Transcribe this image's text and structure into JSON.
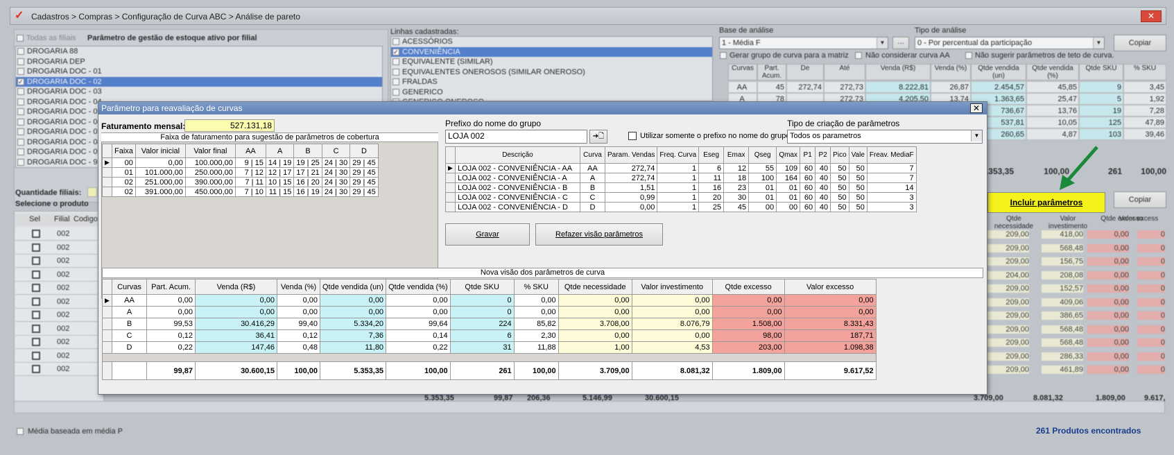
{
  "window": {
    "title": "Cadastros > Compras > Configuração de Curva ABC > Análise de pareto",
    "close": "✕"
  },
  "left_panel": {
    "todas_label": "Todas as filiais",
    "header": "Parâmetro de gestão de estoque ativo por filial",
    "stores": [
      "DROGARIA 88",
      "DROGARIA DEP",
      "DROGARIA DOC - 01",
      "DROGARIA DOC - 02",
      "DROGARIA DOC - 03",
      "DROGARIA DOC - 04",
      "DROGARIA DOC - 05",
      "DROGARIA DOC - 06",
      "DROGARIA DOC - 07",
      "DROGARIA DOC - 08",
      "DROGARIA DOC - 09",
      "DROGARIA DOC - 98"
    ],
    "qtd_filiais": "Quantidade filiais:",
    "selecione": "Selecione o produto"
  },
  "lines_panel": {
    "header": "Linhas cadastradas:",
    "items": [
      "ACESSÓRIOS",
      "CONVENIÊNCIA",
      "EQUIVALENTE (SIMILAR)",
      "EQUIVALENTES ONEROSOS (SIMILAR ONEROSO)",
      "FRALDAS",
      "GENERICO",
      "GENERICO ONEROSO"
    ]
  },
  "right_panel": {
    "base_label": "Base de análise",
    "base_value": "1 - Média F",
    "tipo_label": "Tipo de análise",
    "tipo_value": "0 - Por percentual da participação",
    "copiar": "Copiar",
    "chk1": "Gerar grupo de curva para a matriz",
    "chk2": "Não considerar curva AA",
    "chk3": "Não sugerir parâmetros de teto de curva.",
    "cols": [
      "Curvas",
      "Part. Acum.",
      "De",
      "Até",
      "Venda (R$)",
      "Venda (%)",
      "Qtde vendida (un)",
      "Qtde vendida (%)",
      "Qtde SKU",
      "% SKU"
    ],
    "rows": [
      [
        "AA",
        "45",
        "272,74",
        "272,73",
        "8.222,81",
        "26,87",
        "2.454,57",
        "45,85",
        "9",
        "3,45"
      ],
      [
        "A",
        "78",
        "",
        "272,73",
        "4.205,50",
        "13,74",
        "1.363,65",
        "25,47",
        "5",
        "1,92"
      ],
      [
        "",
        "",
        "",
        "",
        "",
        "",
        "736,67",
        "13,76",
        "19",
        "7,28"
      ],
      [
        "",
        "",
        "",
        "",
        "",
        "",
        "537,81",
        "10,05",
        "125",
        "47,89"
      ],
      [
        "",
        "",
        "",
        "",
        "",
        "",
        "260,65",
        "4,87",
        "103",
        "39,46"
      ]
    ],
    "totals": [
      "5.353,35",
      "100,00",
      "261",
      "100,00"
    ],
    "incluir": "Incluir parâmetros",
    "copiar2": "Copiar",
    "grid2_cols": [
      "Qtde necessidade",
      "Valor investimento",
      "Qtde excesso",
      "Valor excess"
    ],
    "grid2_rows": [
      [
        "209,00",
        "418,00",
        "0,00",
        "0"
      ],
      [
        "209,00",
        "568,48",
        "0,00",
        "0"
      ],
      [
        "209,00",
        "156,75",
        "0,00",
        "0"
      ],
      [
        "204,00",
        "208,08",
        "0,00",
        "0"
      ],
      [
        "209,00",
        "152,57",
        "0,00",
        "0"
      ],
      [
        "209,00",
        "409,06",
        "0,00",
        "0"
      ],
      [
        "209,00",
        "386,65",
        "0,00",
        "0"
      ],
      [
        "209,00",
        "568,48",
        "0,00",
        "0"
      ],
      [
        "209,00",
        "568,48",
        "0,00",
        "0"
      ],
      [
        "209,00",
        "286,33",
        "0,00",
        "0"
      ],
      [
        "209,00",
        "461,89",
        "0,00",
        "0"
      ]
    ],
    "bottom_totals": [
      "3.709,00",
      "8.081,32",
      "1.809,00",
      "9.617,"
    ]
  },
  "products_grid": {
    "cols": [
      "Sel",
      "Filial",
      "Codigo"
    ],
    "filial": "002",
    "totals_row": [
      "5.353,35",
      "99,87",
      "206,36",
      "5.146,99",
      "30.600,15"
    ]
  },
  "status": {
    "media": "Média baseada em média P",
    "found": "261 Produtos encontrados"
  },
  "dialog": {
    "title": "Parâmetro para reavaliação de curvas",
    "close": "✕",
    "fat_label": "Faturamento mensal:",
    "fat_value": "527.131,18",
    "faixa_title": "Faixa de faturamento para sugestão de parâmetros de cobertura",
    "faixa_cols": [
      "Faixa",
      "Valor inicial",
      "Valor final",
      "AA",
      "A",
      "B",
      "C",
      "D"
    ],
    "faixa_rows": [
      [
        "00",
        "0,00",
        "100.000,00",
        "9 | 15",
        "14 | 19",
        "19 | 25",
        "24 | 30",
        "29 | 45"
      ],
      [
        "01",
        "101.000,00",
        "250.000,00",
        "7 | 12",
        "12 | 17",
        "17 | 21",
        "24 | 30",
        "29 | 45"
      ],
      [
        "02",
        "251.000,00",
        "390.000,00",
        "7 | 11",
        "10 | 15",
        "16 | 20",
        "24 | 30",
        "29 | 45"
      ],
      [
        "02",
        "391.000,00",
        "450.000,00",
        "7 | 10",
        "11 | 15",
        "16 | 19",
        "24 | 30",
        "29 | 45"
      ]
    ],
    "prefixo_label": "Prefixo do nome do grupo",
    "prefixo_value": "LOJA 002",
    "btn_apply": "➔🗋",
    "utilizar_label": "Utilizar somente o prefixo no nome do grupo",
    "tipo_label": "Tipo de criação de parâmetros",
    "tipo_value": "Todos os parametros",
    "param_cols": [
      "Descrição",
      "Curva",
      "Param. Vendas",
      "Freq. Curva",
      "Eseg",
      "Emax",
      "Qseg",
      "Qmax",
      "P1",
      "P2",
      "Pico",
      "Vale",
      "Freav. MediaF"
    ],
    "param_rows": [
      [
        "LOJA 002 - CONVENIÊNCIA - AA",
        "AA",
        "272,74",
        "1",
        "6",
        "12",
        "55",
        "109",
        "60",
        "40",
        "50",
        "50",
        "7"
      ],
      [
        "LOJA 002 - CONVENIÊNCIA - A",
        "A",
        "272,74",
        "1",
        "11",
        "18",
        "100",
        "164",
        "60",
        "40",
        "50",
        "50",
        "7"
      ],
      [
        "LOJA 002 - CONVENIÊNCIA - B",
        "B",
        "1,51",
        "1",
        "16",
        "23",
        "01",
        "01",
        "60",
        "40",
        "50",
        "50",
        "14"
      ],
      [
        "LOJA 002 - CONVENIÊNCIA - C",
        "C",
        "0,99",
        "1",
        "20",
        "30",
        "01",
        "01",
        "60",
        "40",
        "50",
        "50",
        "3"
      ],
      [
        "LOJA 002 - CONVENIÊNCIA - D",
        "D",
        "0,00",
        "1",
        "25",
        "45",
        "00",
        "00",
        "60",
        "40",
        "50",
        "50",
        "3"
      ]
    ],
    "gravar": "Gravar",
    "refazer": "Refazer visão parâmetros",
    "nova_title": "Nova visão dos parâmetros de curva",
    "nova_cols": [
      "Curvas",
      "Part. Acum.",
      "Venda (R$)",
      "Venda (%)",
      "Qtde vendida (un)",
      "Qtde vendida (%)",
      "Qtde SKU",
      "% SKU",
      "Qtde necessidade",
      "Valor investimento",
      "Qtde excesso",
      "Valor excesso"
    ],
    "nova_rows": [
      [
        "AA",
        "0,00",
        "0,00",
        "0,00",
        "0,00",
        "0,00",
        "0",
        "0,00",
        "0,00",
        "0,00",
        "0,00",
        "0,00"
      ],
      [
        "A",
        "0,00",
        "0,00",
        "0,00",
        "0,00",
        "0,00",
        "0",
        "0,00",
        "0,00",
        "0,00",
        "0,00",
        "0,00"
      ],
      [
        "B",
        "99,53",
        "30.416,29",
        "99,40",
        "5.334,20",
        "99,64",
        "224",
        "85,82",
        "3.708,00",
        "8.076,79",
        "1.508,00",
        "8.331,43"
      ],
      [
        "C",
        "0,12",
        "36,41",
        "0,12",
        "7,36",
        "0,14",
        "6",
        "2,30",
        "0,00",
        "0,00",
        "98,00",
        "187,71"
      ],
      [
        "D",
        "0,22",
        "147,46",
        "0,48",
        "11,80",
        "0,22",
        "31",
        "11,88",
        "1,00",
        "4,53",
        "203,00",
        "1.098,38"
      ]
    ],
    "nova_totals": [
      "",
      "99,87",
      "30.600,15",
      "100,00",
      "5.353,35",
      "100,00",
      "261",
      "100,00",
      "3.709,00",
      "8.081,32",
      "1.809,00",
      "9.617,52"
    ]
  }
}
